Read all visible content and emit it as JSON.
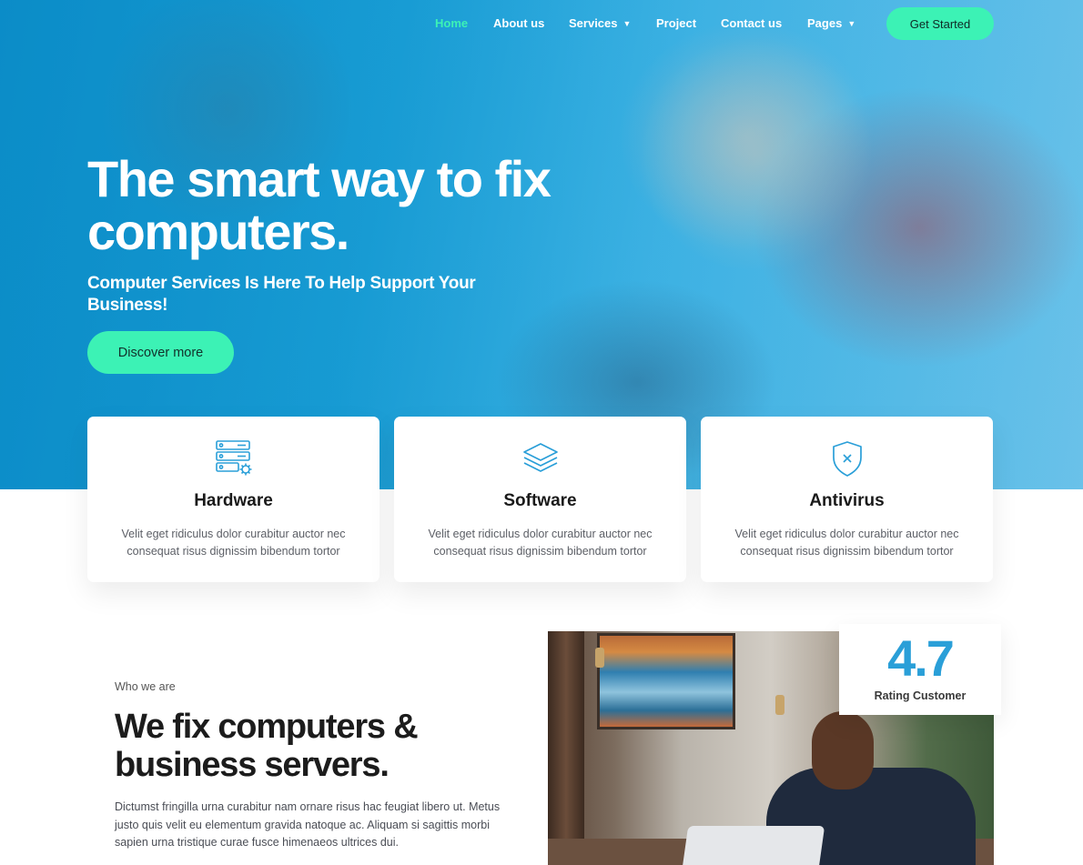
{
  "nav": {
    "items": [
      {
        "label": "Home",
        "active": true,
        "dropdown": false
      },
      {
        "label": "About us",
        "active": false,
        "dropdown": false
      },
      {
        "label": "Services",
        "active": false,
        "dropdown": true
      },
      {
        "label": "Project",
        "active": false,
        "dropdown": false
      },
      {
        "label": "Contact us",
        "active": false,
        "dropdown": false
      },
      {
        "label": "Pages",
        "active": false,
        "dropdown": true
      }
    ],
    "cta_label": "Get Started"
  },
  "hero": {
    "title": "The smart way to fix computers.",
    "subtitle": "Computer Services Is Here To Help Support Your Business!",
    "button_label": "Discover more"
  },
  "services": [
    {
      "icon": "server-gear-icon",
      "title": "Hardware",
      "text": "Velit eget ridiculus dolor curabitur auctor nec consequat risus dignissim bibendum tortor"
    },
    {
      "icon": "layers-icon",
      "title": "Software",
      "text": "Velit eget ridiculus dolor curabitur auctor nec consequat risus dignissim bibendum tortor"
    },
    {
      "icon": "shield-x-icon",
      "title": "Antivirus",
      "text": "Velit eget ridiculus dolor curabitur auctor nec consequat risus dignissim bibendum tortor"
    }
  ],
  "about": {
    "eyebrow": "Who we are",
    "title": "We fix computers & business servers.",
    "text": "Dictumst fringilla urna curabitur nam ornare risus hac feugiat libero ut. Metus justo quis velit eu elementum gravida natoque ac. Aliquam si sagittis morbi sapien urna tristique curae fusce himenaeos ultrices dui."
  },
  "rating": {
    "value": "4.7",
    "label": "Rating Customer"
  },
  "colors": {
    "accent": "#3cf2b5",
    "primary_blue": "#2a9fd8",
    "hero_blue": "#0a8dc7"
  }
}
